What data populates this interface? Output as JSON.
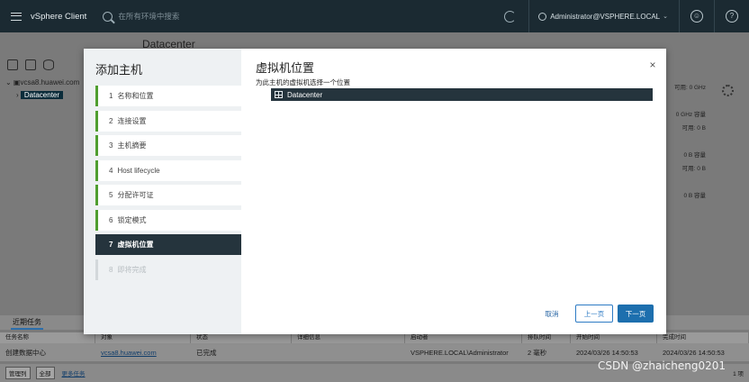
{
  "app": {
    "brand": "vSphere Client",
    "search_placeholder": "在所有环境中搜索",
    "user": "Administrator@VSPHERE.LOCAL",
    "user_caret": "⌄",
    "help_glyph": "?"
  },
  "background": {
    "header_title": "Datacenter",
    "tree": {
      "root": "vcsa8.huawei.com",
      "child": "Datacenter"
    },
    "right_card": [
      "可用: 0 GHz",
      "",
      "0 GHz 容量",
      "可用: 0 B",
      "",
      "0 B 容量",
      "可用: 0 B",
      "",
      "0 B 容量"
    ],
    "bottom_tab": "近期任务",
    "task_columns": [
      "任务名称",
      "对象",
      "状态",
      "详细信息",
      "启动者",
      "排队时间",
      "开始时间",
      "完成时间"
    ],
    "task_row": {
      "name": "创建数据中心",
      "object": "vcsa8.huawei.com",
      "status": "已完成",
      "details": "",
      "initiator": "VSPHERE.LOCAL\\Administrator",
      "queued": "2 毫秒",
      "start": "2024/03/26 14:50:53",
      "end": "2024/03/26 14:50:53"
    },
    "footer": {
      "manage": "管理列",
      "filter": "全部",
      "more": "更多任务",
      "count": "1 项"
    },
    "watermark": "CSDN @zhaicheng0201"
  },
  "wizard": {
    "title": "添加主机",
    "steps": [
      {
        "num": "1",
        "label": "名称和位置"
      },
      {
        "num": "2",
        "label": "连接设置"
      },
      {
        "num": "3",
        "label": "主机摘要"
      },
      {
        "num": "4",
        "label": "Host lifecycle"
      },
      {
        "num": "5",
        "label": "分配许可证"
      },
      {
        "num": "6",
        "label": "锁定模式"
      },
      {
        "num": "7",
        "label": "虚拟机位置"
      },
      {
        "num": "8",
        "label": "即将完成"
      }
    ],
    "page_title": "虚拟机位置",
    "description": "为此主机的虚拟机选择一个位置",
    "tree_item": "Datacenter",
    "buttons": {
      "cancel": "取消",
      "back": "上一页",
      "next": "下一页"
    },
    "close_glyph": "×"
  },
  "colors": {
    "accent": "#1d6fae",
    "completed": "#4f9e2f",
    "active_step": "#25343d",
    "topbar": "#1b2a32"
  }
}
